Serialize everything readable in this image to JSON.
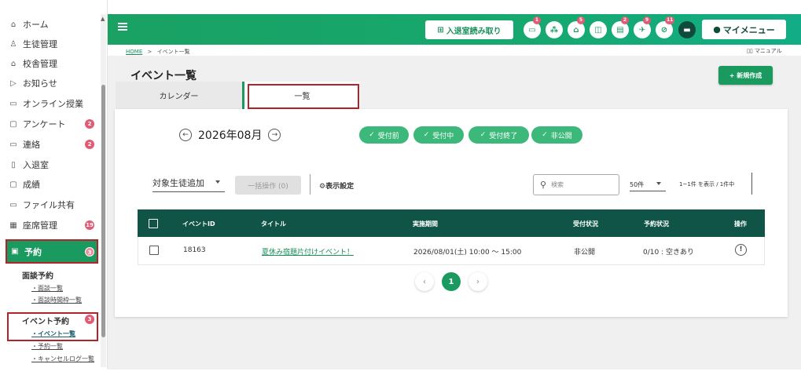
{
  "sidebar": {
    "items": [
      {
        "label": "ホーム",
        "icon": "home-icon",
        "glyph": "⌂"
      },
      {
        "label": "生徒管理",
        "icon": "student-icon",
        "glyph": "♙"
      },
      {
        "label": "校舎管理",
        "icon": "school-icon",
        "glyph": "⌂"
      },
      {
        "label": "お知らせ",
        "icon": "notice-icon",
        "glyph": "▷"
      },
      {
        "label": "オンライン授業",
        "icon": "online-icon",
        "glyph": "▭"
      },
      {
        "label": "アンケート",
        "icon": "survey-icon",
        "glyph": "▢",
        "badge": "2"
      },
      {
        "label": "連絡",
        "icon": "message-icon",
        "glyph": "▭",
        "badge": "2"
      },
      {
        "label": "入退室",
        "icon": "door-icon",
        "glyph": "▯"
      },
      {
        "label": "成績",
        "icon": "grade-icon",
        "glyph": "▢"
      },
      {
        "label": "ファイル共有",
        "icon": "folder-icon",
        "glyph": "▭"
      },
      {
        "label": "座席管理",
        "icon": "seat-icon",
        "glyph": "▦",
        "badge": "19"
      },
      {
        "label": "予約",
        "icon": "calendar-icon",
        "glyph": "▣",
        "badge": "3"
      }
    ],
    "interview": {
      "title": "面談予約",
      "links": [
        "・面談一覧",
        "・面談時間枠一覧"
      ]
    },
    "event": {
      "title": "イベント予約",
      "badge": "3",
      "links": [
        "・イベント一覧",
        "・予約一覧",
        "・キャンセルログ一覧"
      ]
    }
  },
  "header": {
    "qr_label": "入退室読み取り",
    "qr_icon": "qr-icon",
    "icons": [
      {
        "name": "chat-icon",
        "glyph": "▭",
        "badge": "1"
      },
      {
        "name": "group-icon",
        "glyph": "⁂",
        "badge": ""
      },
      {
        "name": "school-icon",
        "glyph": "⌂",
        "badge": "5"
      },
      {
        "name": "gift-icon",
        "glyph": "◫",
        "badge": ""
      },
      {
        "name": "calendar-icon",
        "glyph": "▤",
        "badge": "2"
      },
      {
        "name": "flight-icon",
        "glyph": "✈",
        "badge": "9"
      },
      {
        "name": "block-icon",
        "glyph": "⊘",
        "badge": "11"
      },
      {
        "name": "message-icon",
        "glyph": "▬",
        "badge": ""
      }
    ],
    "my_menu": "マイメニュー"
  },
  "breadcrumb": {
    "home": "HOME",
    "sep": ">",
    "current": "イベント一覧"
  },
  "manual": "マニュアル",
  "page_title": "イベント一覧",
  "new_button": "+ 新規作成",
  "tabs": {
    "calendar": "カレンダー",
    "list": "一覧"
  },
  "month_label": "2026年08月",
  "filters": [
    "受付前",
    "受付中",
    "受付終了",
    "非公開"
  ],
  "toolbar": {
    "target_add": "対象生徒追加",
    "bulk": "一括操作 (0)",
    "display_settings": "表示設定",
    "search_placeholder": "検索",
    "per_page": "50件",
    "count": "1~1件 を表示 / 1件中"
  },
  "table": {
    "headers": {
      "id": "イベントID",
      "title": "タイトル",
      "period": "実施期間",
      "reception": "受付状況",
      "reservation": "予約状況",
      "action": "操作"
    },
    "rows": [
      {
        "id": "18163",
        "title": "夏休み宿題片付けイベント！",
        "period": "2026/08/01(土) 10:00 〜 15:00",
        "reception": "非公開",
        "reservation": "0/10 : 空きあり"
      }
    ]
  },
  "pagination": {
    "current": "1",
    "prev": "‹",
    "next": "›"
  },
  "colors": {
    "primary": "#1a9a5e",
    "header_dark": "#0f5446",
    "highlight": "#b3242a",
    "badge": "#e05b73"
  }
}
